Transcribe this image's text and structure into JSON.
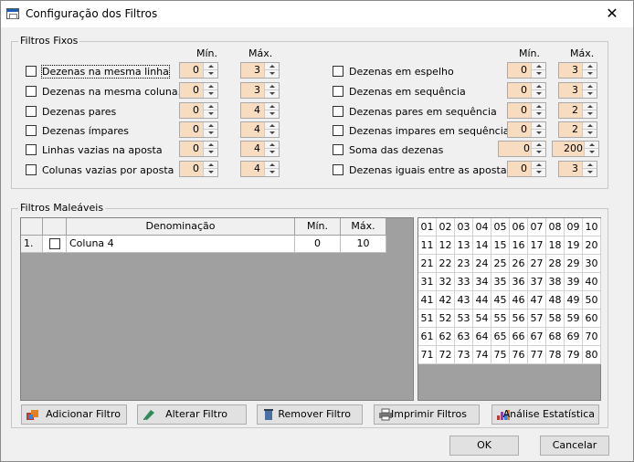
{
  "window": {
    "title": "Configuração dos Filtros",
    "close_glyph": "✕"
  },
  "fixed": {
    "label": "Filtros Fixos",
    "min_label": "Mín.",
    "max_label": "Máx.",
    "left": [
      {
        "label": "Dezenas na mesma linha",
        "min": "0",
        "max": "3"
      },
      {
        "label": "Dezenas na mesma coluna.",
        "min": "0",
        "max": "3"
      },
      {
        "label": "Dezenas pares",
        "min": "0",
        "max": "4"
      },
      {
        "label": "Dezenas ímpares",
        "min": "0",
        "max": "4"
      },
      {
        "label": "Linhas vazias na aposta",
        "min": "0",
        "max": "4"
      },
      {
        "label": "Colunas vazias por aposta",
        "min": "0",
        "max": "4"
      }
    ],
    "right": [
      {
        "label": "Dezenas em espelho",
        "min": "0",
        "max": "3"
      },
      {
        "label": "Dezenas em  sequência",
        "min": "0",
        "max": "3"
      },
      {
        "label": "Dezenas pares em sequência",
        "min": "0",
        "max": "2"
      },
      {
        "label": "Dezenas  impares em sequência",
        "min": "0",
        "max": "2"
      },
      {
        "label": "Soma das dezenas",
        "min": "0",
        "max": "200"
      },
      {
        "label": "Dezenas iguais entre as apostas",
        "min": "0",
        "max": "3"
      }
    ]
  },
  "malleable": {
    "label": "Filtros Maleáveis",
    "headers": {
      "name": "Denominação",
      "min": "Mín.",
      "max": "Máx."
    },
    "rows": [
      {
        "index": "1.",
        "name": "Coluna 4",
        "min": "0",
        "max": "10"
      }
    ]
  },
  "numbers": [
    "01",
    "02",
    "03",
    "04",
    "05",
    "06",
    "07",
    "08",
    "09",
    "10",
    "11",
    "12",
    "13",
    "14",
    "15",
    "16",
    "17",
    "18",
    "19",
    "20",
    "21",
    "22",
    "23",
    "24",
    "25",
    "26",
    "27",
    "28",
    "29",
    "30",
    "31",
    "32",
    "33",
    "34",
    "35",
    "36",
    "37",
    "38",
    "39",
    "40",
    "41",
    "42",
    "43",
    "44",
    "45",
    "46",
    "47",
    "48",
    "49",
    "50",
    "51",
    "52",
    "53",
    "54",
    "55",
    "56",
    "57",
    "58",
    "59",
    "60",
    "61",
    "62",
    "63",
    "64",
    "65",
    "66",
    "67",
    "68",
    "69",
    "70",
    "71",
    "72",
    "73",
    "74",
    "75",
    "76",
    "77",
    "78",
    "79",
    "80"
  ],
  "buttons": {
    "add": "Adicionar Filtro",
    "edit": "Alterar Filtro",
    "remove": "Remover Filtro",
    "print": "Imprimir Filtros",
    "stats": "Análise Estatística",
    "ok": "OK",
    "cancel": "Cancelar"
  },
  "icons": {
    "add": "add-filter-icon",
    "edit": "edit-filter-icon",
    "remove": "remove-filter-icon",
    "print": "printer-icon",
    "stats": "statistics-icon"
  }
}
